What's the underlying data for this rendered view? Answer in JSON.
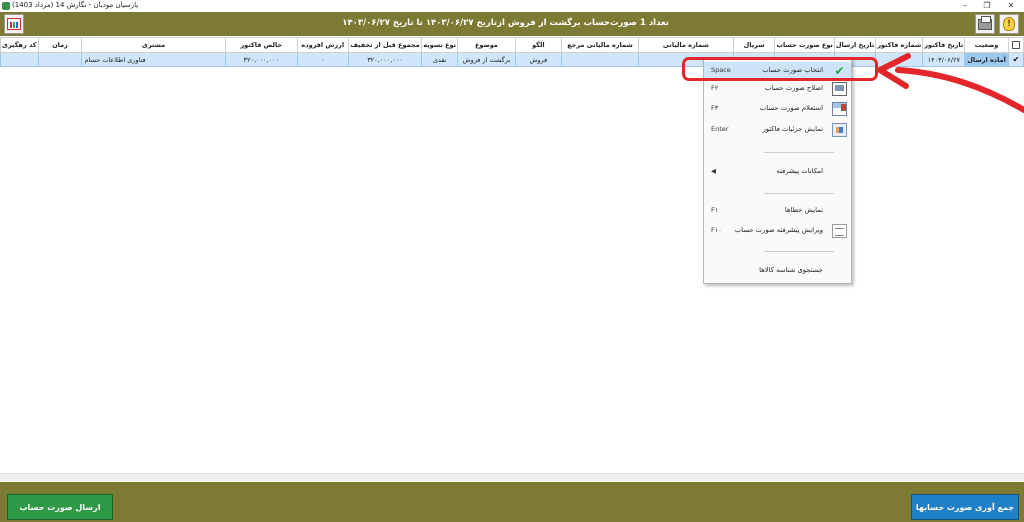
{
  "window": {
    "title": "پارسیان مودیان - نگارش 14 (مرداد 1403)",
    "minimize": "–",
    "maximize": "❐",
    "close": "✕"
  },
  "header": {
    "text": "تعداد  1  صورت‌حساب  برگشت از فروش  ازتاریخ  ۱۴۰۳/۰۶/۲۷  تا تاریخ  ۱۴۰۳/۰۶/۲۷"
  },
  "grid": {
    "columns": [
      {
        "label": ""
      },
      {
        "label": "وضعیت"
      },
      {
        "label": "تاریخ فاکتور"
      },
      {
        "label": "شماره فاکتور"
      },
      {
        "label": "تاریخ ارسال"
      },
      {
        "label": "نوع صورت حساب"
      },
      {
        "label": "سریال"
      },
      {
        "label": "شماره مالیاتی"
      },
      {
        "label": "شماره مالیاتی مرجع"
      },
      {
        "label": "الگو"
      },
      {
        "label": "موضوع"
      },
      {
        "label": "نوع تسویه"
      },
      {
        "label": "مجموع قبل از تخفیف"
      },
      {
        "label": "ارزش افزوده"
      },
      {
        "label": "خالص فاکتور"
      },
      {
        "label": "مشتری"
      },
      {
        "label": "زمان"
      },
      {
        "label": "کد رهگیری"
      }
    ],
    "rows": [
      {
        "check": "✔",
        "state": "آماده ارسال",
        "invoice_date": "۱۴۰۳/۰۶/۲۷",
        "invoice_no": "۱",
        "send_date": "",
        "invoice_type": "",
        "serial": "",
        "tax_no": "",
        "ref_tax_no": "",
        "pattern": "فروش",
        "subject": "برگشت از فروش",
        "settlement": "نقدی",
        "total_before_discount": "۳۲۰,۰۰۰,۰۰۰",
        "vat": "۰",
        "net": "۳۲۰,۰۰۰,۰۰۰",
        "customer": "فناوری اطلاعات حسام",
        "time": "",
        "tracking": ""
      }
    ]
  },
  "context_menu": {
    "items": [
      {
        "label": "انتخاب صورت حساب",
        "shortcut": "Space",
        "icon": "check-icon"
      },
      {
        "label": "اصلاح صورت حساب",
        "shortcut": "F۲",
        "icon": "edit-icon"
      },
      {
        "label": "استعلام صورت حساب",
        "shortcut": "F۳",
        "icon": "inquiry-icon"
      },
      {
        "label": "نمایش جزئیات فاکتور",
        "shortcut": "Enter",
        "icon": "details-icon"
      },
      {
        "label": "امکانات پیشرفته",
        "shortcut": "",
        "icon": "submenu-arrow-icon"
      },
      {
        "label": "نمایش خطاها",
        "shortcut": "F۱",
        "icon": ""
      },
      {
        "label": "ویرایش پیشرفته صورت حساب",
        "shortcut": "F۱۰",
        "icon": "advanced-edit-icon"
      },
      {
        "label": "جستجوی شناسه کالاها",
        "shortcut": "",
        "icon": ""
      }
    ],
    "submenu_arrow": "◀"
  },
  "footer": {
    "send_label": "ارسال صورت حساب",
    "collect_label": "جمع آوری صورت حسابها"
  },
  "colors": {
    "header_bar": "#7d7a34",
    "selected_row": "#cfe6fb",
    "send_button": "#2e9a48",
    "collect_button": "#1f7fc7",
    "annotation": "#e3262a"
  }
}
